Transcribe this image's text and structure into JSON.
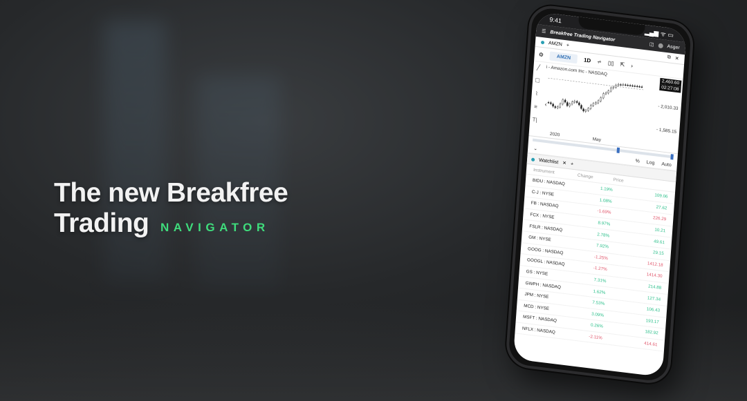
{
  "hero": {
    "headline": "The new Breakfree Trading",
    "subhead": "NAVIGATOR"
  },
  "status_bar": {
    "time": "9:41",
    "signal": "▂▄▆ ᯤ ▭"
  },
  "app_bar": {
    "menu_icon": "☰",
    "brand": "Breakfree Trading Navigator",
    "user": "Asger",
    "layout_icon": "◫"
  },
  "chart_tab": {
    "symbol": "AMZN",
    "add": "+",
    "restore_icon": "⧉",
    "close_icon": "✕"
  },
  "toolbar": {
    "gear": "⚙",
    "symbol": "AMZN",
    "interval": "1D",
    "indicators": "⩫",
    "candles": "▯▯",
    "cursor": "⇱",
    "more": "›"
  },
  "chart": {
    "title": "i - Amazon.com Inc - NASDAQ",
    "last_price": "2,460.60",
    "countdown": "02:27:08",
    "levels": [
      "- 2,010.33",
      "- 1,585.15"
    ],
    "x_labels": [
      "2020",
      "May"
    ],
    "left_tools": [
      "╱",
      "☐",
      "⌇",
      "≡",
      "T|"
    ],
    "nav_arrow": "‹"
  },
  "scale": {
    "collapse": "⌄",
    "percent": "%",
    "log": "Log",
    "auto": "Auto"
  },
  "watchlist": {
    "tab_label": "Watchlist",
    "close": "✕",
    "add": "+",
    "headers": [
      "Instrument",
      "Change",
      "Price"
    ],
    "rows": [
      {
        "symbol": "BIDU : NASDAQ",
        "change": "1.19%",
        "price": "109.06",
        "dir": "pos"
      },
      {
        "symbol": "C-J : NYSE",
        "change": "1.08%",
        "price": "27.62",
        "dir": "pos"
      },
      {
        "symbol": "FB : NASDAQ",
        "change": "-1.69%",
        "price": "226.29",
        "dir": "neg"
      },
      {
        "symbol": "FCX : NYSE",
        "change": "8.97%",
        "price": "10.21",
        "dir": "pos"
      },
      {
        "symbol": "FSLR : NASDAQ",
        "change": "2.78%",
        "price": "49.61",
        "dir": "pos"
      },
      {
        "symbol": "GM : NYSE",
        "change": "7.92%",
        "price": "29.15",
        "dir": "pos"
      },
      {
        "symbol": "GOOG : NASDAQ",
        "change": "-1.25%",
        "price": "1412.18",
        "dir": "neg"
      },
      {
        "symbol": "GOOGL : NASDAQ",
        "change": "-1.27%",
        "price": "1414.30",
        "dir": "neg"
      },
      {
        "symbol": "GS : NYSE",
        "change": "7.31%",
        "price": "214.88",
        "dir": "pos"
      },
      {
        "symbol": "GWPH : NASDAQ",
        "change": "1.62%",
        "price": "127.34",
        "dir": "pos"
      },
      {
        "symbol": "JPM : NYSE",
        "change": "7.53%",
        "price": "106.43",
        "dir": "pos"
      },
      {
        "symbol": "MCD : NYSE",
        "change": "3.09%",
        "price": "193.17",
        "dir": "pos"
      },
      {
        "symbol": "MSFT : NASDAQ",
        "change": "0.26%",
        "price": "182.92",
        "dir": "pos"
      },
      {
        "symbol": "NFLX : NASDAQ",
        "change": "-2.11%",
        "price": "414.61",
        "dir": "neg"
      }
    ]
  },
  "colors": {
    "accent": "#3fdc7c",
    "positive": "#2bbf8a",
    "negative": "#e0556a"
  }
}
